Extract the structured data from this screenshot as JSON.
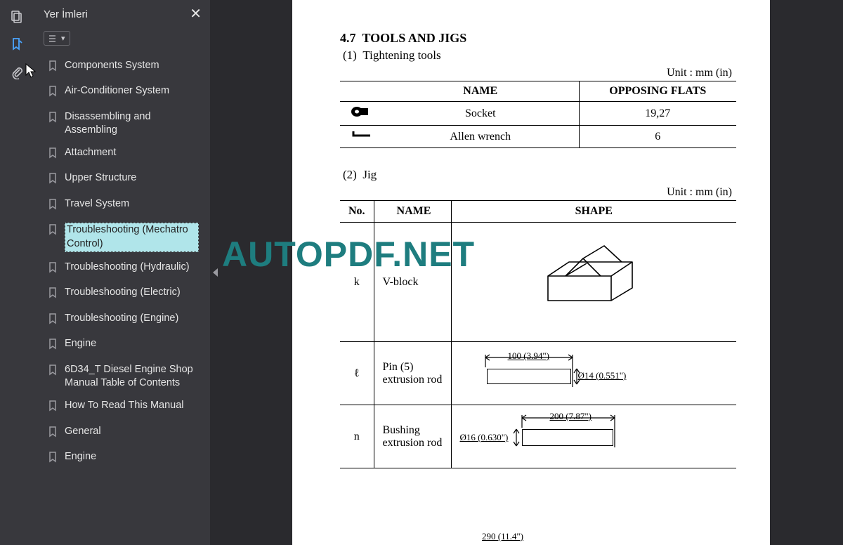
{
  "sidebar": {
    "title": "Yer İmleri",
    "items": [
      {
        "label": "Components System",
        "selected": false
      },
      {
        "label": "Air-Conditioner System",
        "selected": false
      },
      {
        "label": "Disassembling and Assembling",
        "selected": false
      },
      {
        "label": "Attachment",
        "selected": false
      },
      {
        "label": "Upper Structure",
        "selected": false
      },
      {
        "label": "Travel System",
        "selected": false
      },
      {
        "label": "Troubleshooting (Mechatro Control)",
        "selected": true
      },
      {
        "label": "Troubleshooting (Hydraulic)",
        "selected": false
      },
      {
        "label": "Troubleshooting (Electric)",
        "selected": false
      },
      {
        "label": "Troubleshooting (Engine)",
        "selected": false
      },
      {
        "label": "Engine",
        "selected": false
      },
      {
        "label": "6D34_T Diesel Engine Shop Manual Table of Contents",
        "selected": false
      },
      {
        "label": "How To Read This Manual",
        "selected": false
      },
      {
        "label": "General",
        "selected": false
      },
      {
        "label": "Engine",
        "selected": false
      }
    ]
  },
  "watermark": "AUTOPDF.NET",
  "doc": {
    "section_no": "4.7",
    "section_title": "TOOLS AND JIGS",
    "sub1_no": "(1)",
    "sub1_title": "Tightening tools",
    "unit_label": "Unit : mm (in)",
    "tools_header_name": "NAME",
    "tools_header_opposing": "OPPOSING   FLATS",
    "tools_rows": [
      {
        "name": "Socket",
        "value": "19,27"
      },
      {
        "name": "Allen wrench",
        "value": "6"
      }
    ],
    "sub2_no": "(2)",
    "sub2_title": "Jig",
    "jig_header_no": "No.",
    "jig_header_name": "NAME",
    "jig_header_shape": "SHAPE",
    "jig_rows": [
      {
        "no": "k",
        "name": "V-block"
      },
      {
        "no": "ℓ",
        "name": "Pin (5) extrusion rod",
        "dim_w": "100 (3.94\")",
        "dim_h": "Ø14 (0.551\")"
      },
      {
        "no": "n",
        "name": "Bushing extrusion rod",
        "dim_w": "200 (7.87\")",
        "dim_h": "Ø16 (0.630\")"
      }
    ],
    "bottom_dim": "290 (11.4\")"
  }
}
